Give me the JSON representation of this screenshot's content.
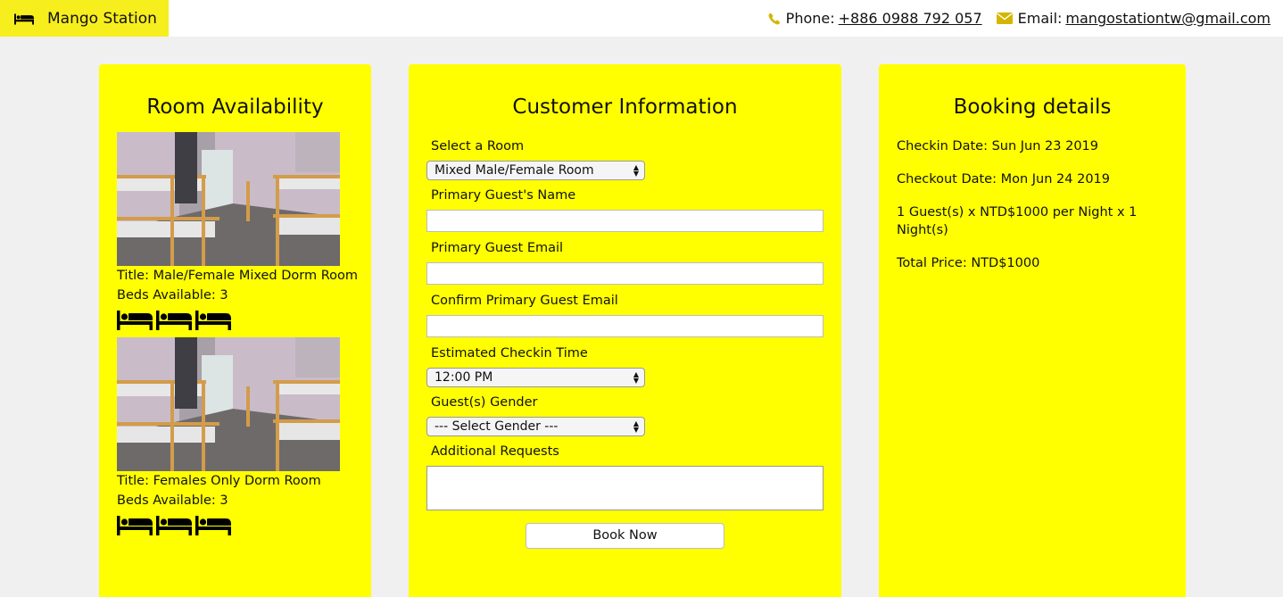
{
  "header": {
    "brand_name": "Mango Station",
    "phone_label": "Phone:",
    "phone_value": "+886 0988 792 057",
    "email_label": "Email:",
    "email_value": "mangostationtw@gmail.com"
  },
  "colors": {
    "accent_yellow": "#ffff00",
    "brand_yellow": "#f7ee1d",
    "icon_gold": "#d4b600"
  },
  "icons": {
    "brand": "bed-icon",
    "phone": "phone-icon",
    "email": "envelope-icon",
    "bed": "bed-icon"
  },
  "rooms_panel": {
    "title": "Room Availability",
    "rooms": [
      {
        "title": "Title: Male/Female Mixed Dorm Room",
        "beds": "Beds Available: 3",
        "bed_count": 3
      },
      {
        "title": "Title: Females Only Dorm Room",
        "beds": "Beds Available: 3",
        "bed_count": 3
      }
    ]
  },
  "customer_panel": {
    "title": "Customer Information",
    "room_label": "Select a Room",
    "room_value": "Mixed Male/Female Room",
    "name_label": "Primary Guest's Name",
    "name_value": "",
    "email_label": "Primary Guest Email",
    "email_value": "",
    "confirm_email_label": "Confirm Primary Guest Email",
    "confirm_email_value": "",
    "checkin_label": "Estimated Checkin Time",
    "checkin_value": "12:00 PM",
    "gender_label": "Guest(s) Gender",
    "gender_value": "--- Select Gender ---",
    "requests_label": "Additional Requests",
    "requests_value": "",
    "book_button": "Book Now"
  },
  "booking_panel": {
    "title": "Booking details",
    "checkin": "Checkin Date: Sun Jun 23 2019",
    "checkout": "Checkout Date: Mon Jun 24 2019",
    "price_line": "1 Guest(s) x NTD$1000 per Night x 1 Night(s)",
    "total": "Total Price: NTD$1000"
  }
}
